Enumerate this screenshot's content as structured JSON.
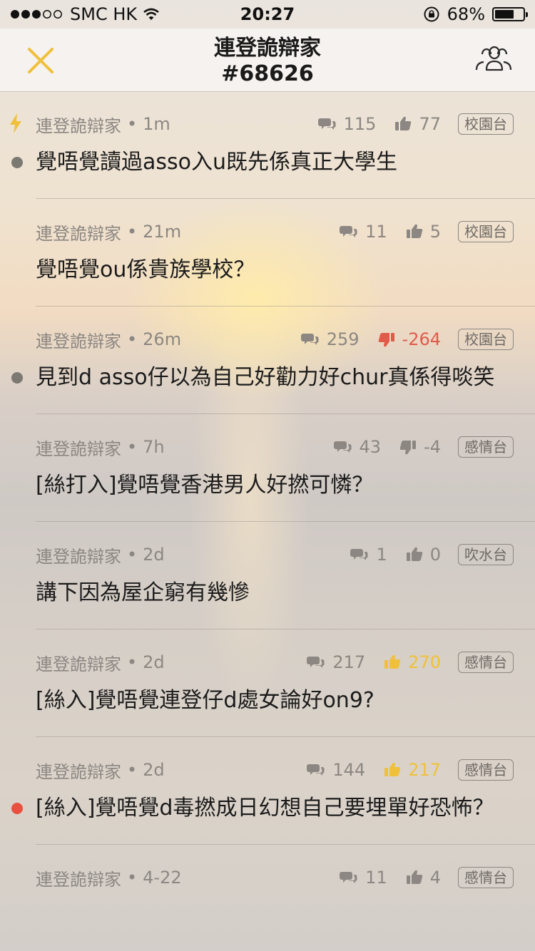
{
  "status_bar": {
    "carrier": "SMC HK",
    "time": "20:27",
    "battery": "68%",
    "battery_level": 0.68
  },
  "header": {
    "title": "連登詭辯家",
    "subtitle": "#68626"
  },
  "colors": {
    "accent_yellow": "#f0c03a",
    "negative_red": "#e25a4a",
    "unread_gray": "#7c7872",
    "hot_red": "#e8503f"
  },
  "threads": [
    {
      "author": "連登詭辯家",
      "time": "1m",
      "replies": "115",
      "votes": "77",
      "vote_type": "up",
      "tag": "校園台",
      "title": "覺唔覺讀過asso入u既先係真正大學生",
      "marker": "flash+gray"
    },
    {
      "author": "連登詭辯家",
      "time": "21m",
      "replies": "11",
      "votes": "5",
      "vote_type": "up",
      "tag": "校園台",
      "title": "覺唔覺ou係貴族學校？",
      "marker": "none"
    },
    {
      "author": "連登詭辯家",
      "time": "26m",
      "replies": "259",
      "votes": "-264",
      "vote_type": "down-red",
      "tag": "校園台",
      "title": "見到d asso仔以為自己好勸力好chur真係得啖笑",
      "marker": "gray"
    },
    {
      "author": "連登詭辯家",
      "time": "7h",
      "replies": "43",
      "votes": "-4",
      "vote_type": "down",
      "tag": "感情台",
      "title": "[絲打入]覺唔覺香港男人好撚可憐？",
      "marker": "none"
    },
    {
      "author": "連登詭辯家",
      "time": "2d",
      "replies": "1",
      "votes": "0",
      "vote_type": "up",
      "tag": "吹水台",
      "title": "講下因為屋企窮有幾慘",
      "marker": "none"
    },
    {
      "author": "連登詭辯家",
      "time": "2d",
      "replies": "217",
      "votes": "270",
      "vote_type": "up-gold",
      "tag": "感情台",
      "title": "[絲入]覺唔覺連登仔d處女論好on9?",
      "marker": "none"
    },
    {
      "author": "連登詭辯家",
      "time": "2d",
      "replies": "144",
      "votes": "217",
      "vote_type": "up-gold",
      "tag": "感情台",
      "title": "[絲入]覺唔覺d毒撚成日幻想自己要埋單好恐怖？",
      "marker": "red"
    },
    {
      "author": "連登詭辯家",
      "time": "4-22",
      "replies": "11",
      "votes": "4",
      "vote_type": "up",
      "tag": "感情台",
      "title": "",
      "marker": "none"
    }
  ]
}
